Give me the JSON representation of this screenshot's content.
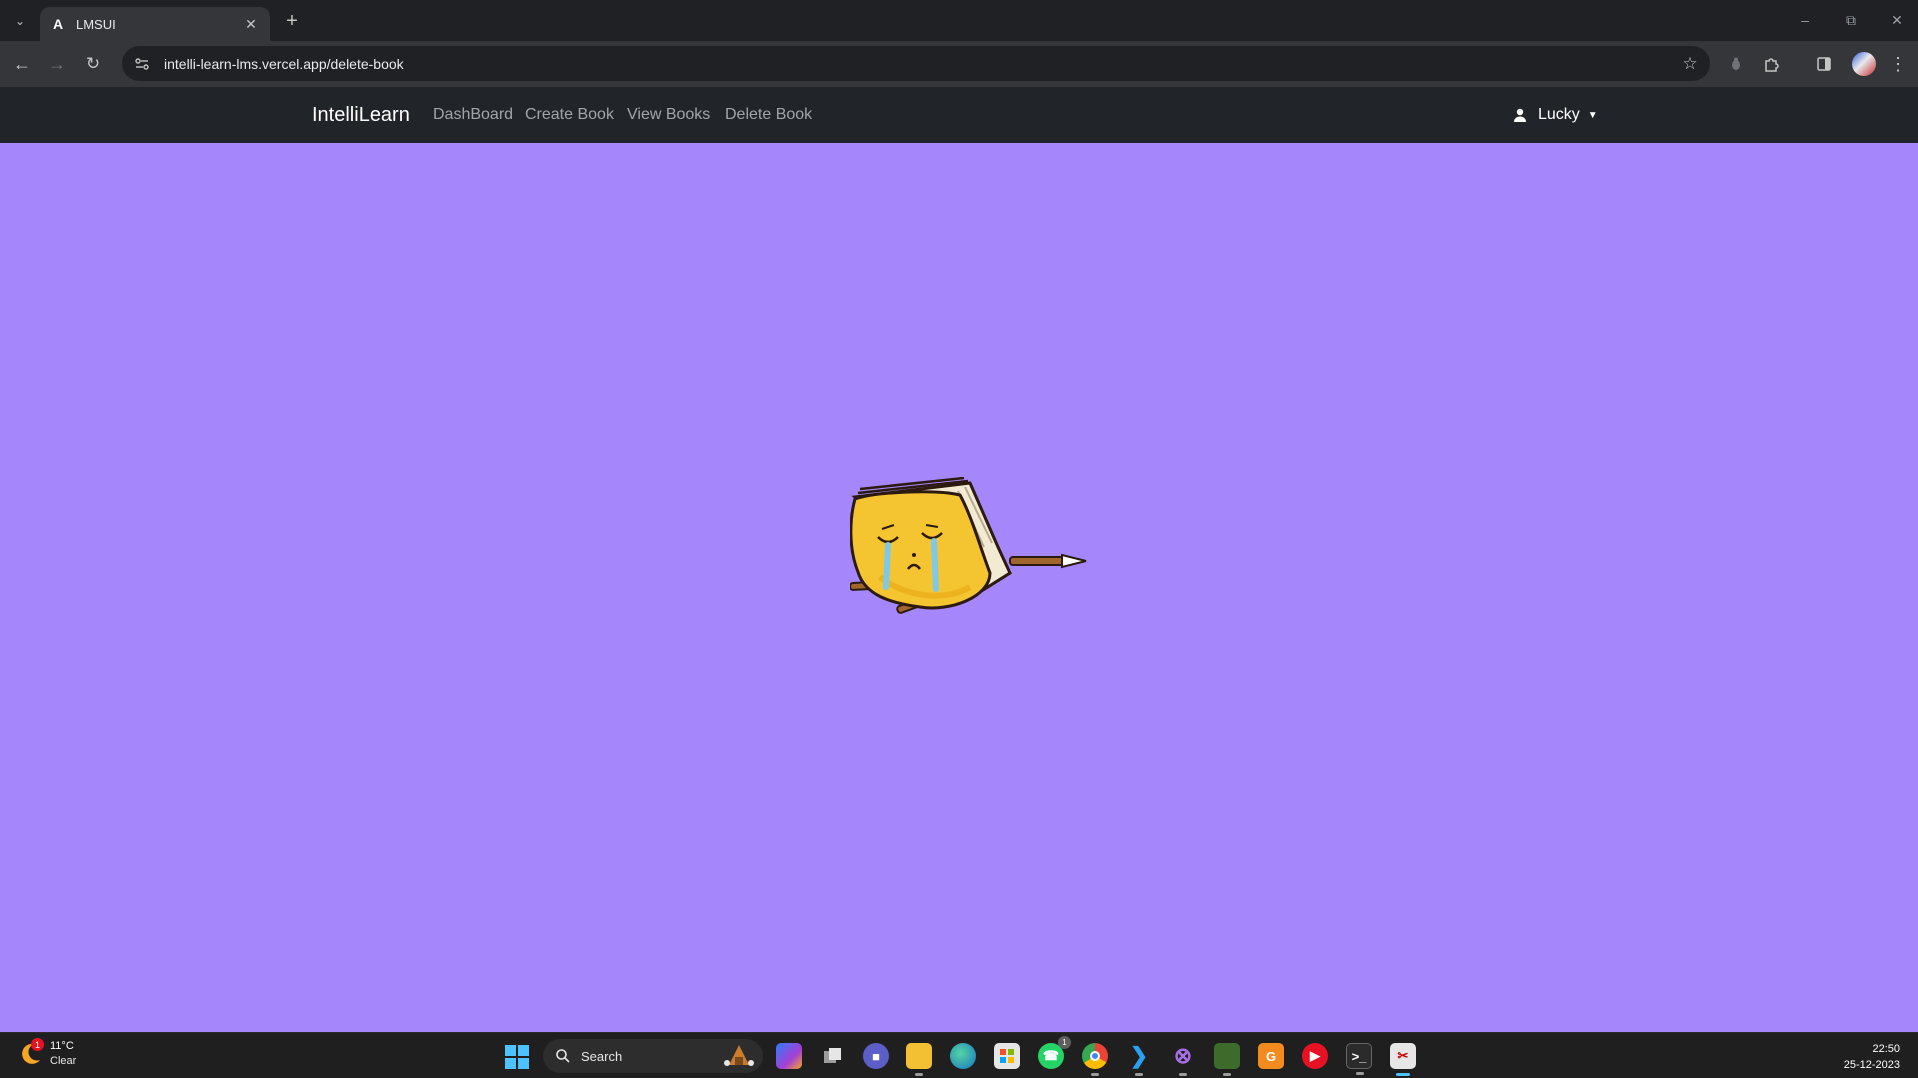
{
  "browser": {
    "tab_title": "LMSUI",
    "tab_favicon": "A",
    "url": "intelli-learn-lms.vercel.app/delete-book"
  },
  "navbar": {
    "brand": "IntelliLearn",
    "links": [
      "DashBoard",
      "Create Book",
      "View Books",
      "Delete Book"
    ],
    "user": "Lucky"
  },
  "content": {
    "illustration": "crying-book-icon",
    "background_color": "#a586fb"
  },
  "taskbar": {
    "weather_temp": "11°C",
    "weather_condition": "Clear",
    "weather_badge": "1",
    "search_label": "Search",
    "whatsapp_badge": "1",
    "time": "22:50",
    "date": "25-12-2023"
  },
  "colors": {
    "navbar_bg": "#212529",
    "page_bg": "#a586fb",
    "chrome_bg": "#202124",
    "toolbar_bg": "#35363a"
  }
}
